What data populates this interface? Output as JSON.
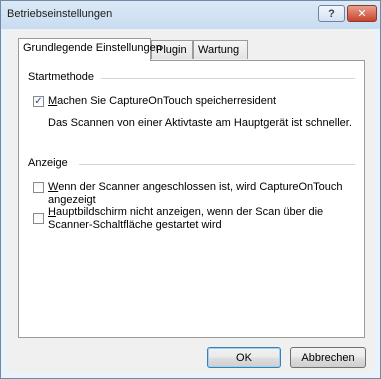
{
  "window": {
    "title": "Betriebseinstellungen",
    "help_label": "?",
    "close_label": "✕"
  },
  "tabs": [
    {
      "label": "Grundlegende Einstellungen",
      "active": true
    },
    {
      "label": "Plugin",
      "active": false
    },
    {
      "label": "Wartung",
      "active": false
    }
  ],
  "start": {
    "group_label": "Startmethode",
    "resident": {
      "mark": "✓",
      "checked": true,
      "mnemonic": "M",
      "rest": "achen Sie CaptureOnTouch speicherresident"
    },
    "info": "Das Scannen von einer Aktivtaste am Hauptgerät ist schneller."
  },
  "display": {
    "group_label": "Anzeige",
    "show_when_connected": {
      "checked": false,
      "mnemonic": "W",
      "rest": "enn der Scanner angeschlossen ist, wird CaptureOnTouch angezeigt"
    },
    "hide_main": {
      "checked": false,
      "mnemonic": "H",
      "rest_line1": "auptbildschirm nicht anzeigen, wenn der Scan über die",
      "line2": "Scanner-Schaltfläche gestartet wird"
    }
  },
  "buttons": {
    "ok": "OK",
    "cancel": "Abbrechen"
  }
}
